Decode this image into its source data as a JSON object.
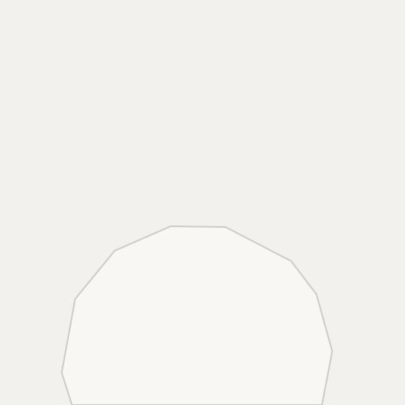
{
  "map": {
    "tile_type": "vector map tile (unlabeled)",
    "colors": {
      "background": "#f2f1ed",
      "area_fill": "#f8f7f4",
      "area_outline": "#cdcdc8"
    },
    "features": [
      {
        "kind": "polygon-area",
        "label": ""
      }
    ]
  }
}
